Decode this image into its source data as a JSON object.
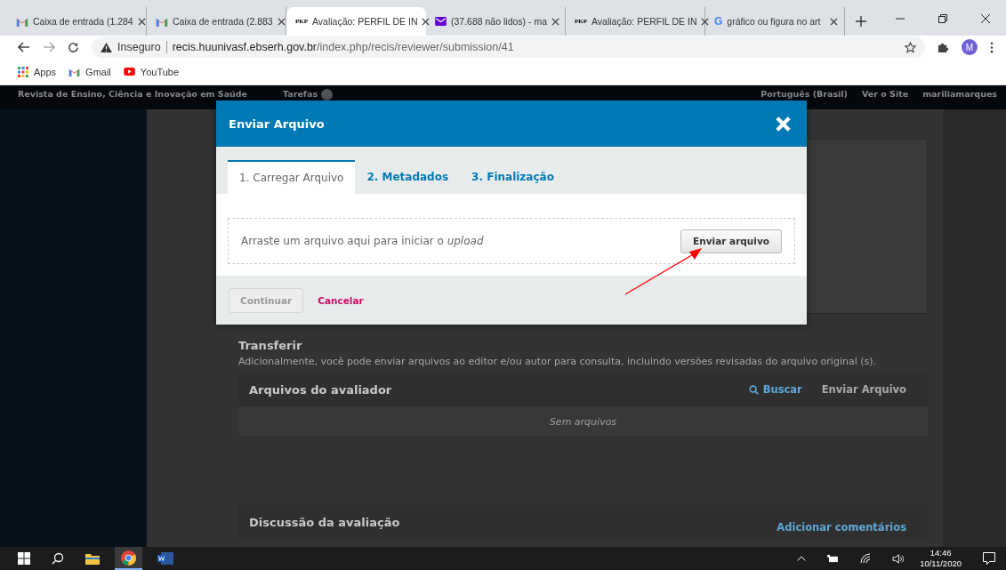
{
  "browser": {
    "tabs": [
      {
        "title": "Caixa de entrada (1.284",
        "kind": "gmail",
        "selected": false
      },
      {
        "title": "Caixa de entrada (2.883",
        "kind": "gmail",
        "selected": false
      },
      {
        "title": "Avaliação: PERFIL DE IN",
        "kind": "pkp",
        "favicon_text": "PKP",
        "selected": true
      },
      {
        "title": "(37.688 não lidos) - ma",
        "kind": "mail",
        "selected": false
      },
      {
        "title": "Avaliação: PERFIL DE IN",
        "kind": "pkp",
        "favicon_text": "PKP",
        "selected": false
      },
      {
        "title": "gráfico ou figura no art",
        "kind": "google",
        "favicon_text": "G",
        "selected": false
      }
    ],
    "address": {
      "security": "Inseguro",
      "host": "recis.huunivasf.ebserh.gov.br",
      "path": "/index.php/recis/reviewer/submission/41"
    },
    "profile_initial": "M",
    "bookmarks": [
      {
        "label": "Apps",
        "kind": "apps"
      },
      {
        "label": "Gmail",
        "kind": "gmail"
      },
      {
        "label": "YouTube",
        "kind": "youtube"
      }
    ]
  },
  "site_nav": {
    "journal": "Revista de Ensino, Ciência e Inovação em Saúde",
    "tasks": "Tarefas",
    "language": "Português (Brasil)",
    "view_site": "Ver o Site",
    "user": "mariliamarques"
  },
  "page": {
    "transfer_title": "Transferir",
    "transfer_text": "Adicionalmente, você pode enviar arquivos ao editor e/ou autor para consulta, incluindo versões revisadas do arquivo original (s).",
    "reviewer_files": {
      "title": "Arquivos do avaliador",
      "search": "Buscar",
      "upload": "Enviar Arquivo",
      "empty": "Sem arquivos"
    },
    "discussion": {
      "title": "Discussão da avaliação",
      "add": "Adicionar comentários"
    }
  },
  "modal": {
    "title": "Enviar Arquivo",
    "tabs": [
      {
        "label": "1. Carregar Arquivo",
        "selected": true
      },
      {
        "label": "2. Metadados",
        "selected": false
      },
      {
        "label": "3. Finalização",
        "selected": false
      }
    ],
    "dropzone_text": "Arraste um arquivo aqui para iniciar o *upload*",
    "upload_button": "Enviar arquivo",
    "continue": {
      "label": "Continuar",
      "disabled": true
    },
    "cancel": "Cancelar"
  },
  "taskbar": {
    "time": "14:46",
    "date": "10/11/2020"
  }
}
